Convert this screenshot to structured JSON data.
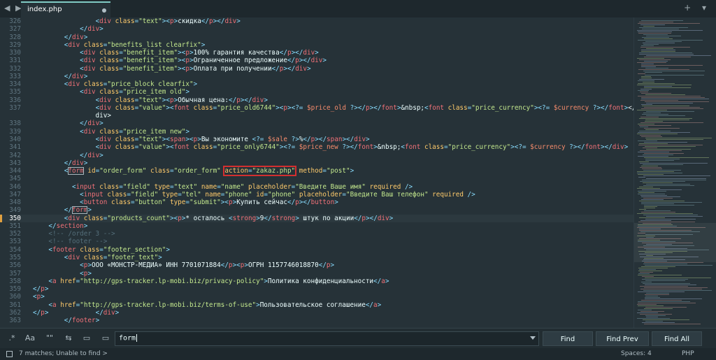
{
  "tabbar": {
    "nav_arrows": "◀ ▶",
    "tab_label": "index.php",
    "right_controls": "+ ▾"
  },
  "editor": {
    "current_line": "350",
    "lines": [
      {
        "n": "326",
        "code": "                <div class=\"text\"><p>скидка</p></div>"
      },
      {
        "n": "327",
        "code": "            </div>"
      },
      {
        "n": "328",
        "code": "        </div>"
      },
      {
        "n": "329",
        "code": "        <div class=\"benefits_list clearfix\">"
      },
      {
        "n": "330",
        "code": "            <div class=\"benefit_item\"><p>100% гарантия качества</p></div>"
      },
      {
        "n": "331",
        "code": "            <div class=\"benefit_item\"><p>Ограниченное предложение</p></div>"
      },
      {
        "n": "332",
        "code": "            <div class=\"benefit_item\"><p>Оплата при получении</p></div>"
      },
      {
        "n": "333",
        "code": "        </div>"
      },
      {
        "n": "334",
        "code": "        <div class=\"price_block clearfix\">"
      },
      {
        "n": "335",
        "code": "            <div class=\"price_item old\">"
      },
      {
        "n": "336",
        "code": "                <div class=\"text\"><p>Обычная цена:</p></div>"
      },
      {
        "n": "337",
        "code": "                <div class=\"value\"><font class=\"price_old6744\"><p><?= $price_old ?></p></font>&nbsp;<font class=\"price_currency\"><?= $currency ?></font></"
      },
      {
        "n": "",
        "code": "                div>"
      },
      {
        "n": "338",
        "code": "            </div>"
      },
      {
        "n": "339",
        "code": "            <div class=\"price_item new\">"
      },
      {
        "n": "340",
        "code": "                <div class=\"text\"><span><p>Вы экономите <?= $sale ?>%</p></span></div>"
      },
      {
        "n": "341",
        "code": "                <div class=\"value\"><font class=\"price_only6744\"><?= $price_new ?></font>&nbsp;<font class=\"price_currency\"><?= $currency ?></font></div>"
      },
      {
        "n": "342",
        "code": "            </div>"
      },
      {
        "n": "343",
        "code": "        </div>"
      },
      {
        "n": "344",
        "code": "        <form id=\"order_form\" class=\"order_form\" action=\"zakaz.php\" method=\"post\">"
      },
      {
        "n": "345",
        "code": ""
      },
      {
        "n": "346",
        "code": "          <input class=\"field\" type=\"text\" name=\"name\" placeholder=\"Введите Ваше имя\" required />"
      },
      {
        "n": "347",
        "code": "            <input class=\"field\" type=\"tel\" name=\"phone\" id=\"phone\" placeholder=\"Введите Ваш телефон\" required />"
      },
      {
        "n": "348",
        "code": "            <button class=\"button\" type=\"submit\"><p>Купить сейчас</p></button>"
      },
      {
        "n": "349",
        "code": "        </form>"
      },
      {
        "n": "350",
        "code": "        <div class=\"products_count\"><p>* осталось <strong>9</strong> штук по акции</p></div>"
      },
      {
        "n": "351",
        "code": "    </section>"
      },
      {
        "n": "352",
        "code": "    <!-- /order 3 -->"
      },
      {
        "n": "353",
        "code": "    <!-- footer -->"
      },
      {
        "n": "354",
        "code": "    <footer class=\"footer_section\">"
      },
      {
        "n": "355",
        "code": "        <div class=\"footer_text\">"
      },
      {
        "n": "356",
        "code": "            <p>ООО «МОНСТР-МЕДИА» ИНН 7701071884</p><p>ОГРН 1157746018870</p>"
      },
      {
        "n": "357",
        "code": "            <p>"
      },
      {
        "n": "358",
        "code": "    <a href=\"http://gps-tracker.lp-mobi.biz/privacy-policy\">Политика конфиденциальности</a>"
      },
      {
        "n": "359",
        "code": "</p>"
      },
      {
        "n": "360",
        "code": "<p>"
      },
      {
        "n": "361",
        "code": "    <a href=\"http://gps-tracker.lp-mobi.biz/terms-of-use\">Пользовательское соглашение</a>"
      },
      {
        "n": "362",
        "code": "</p>            </div>"
      },
      {
        "n": "363",
        "code": "        </footer>"
      }
    ]
  },
  "find_panel": {
    "options": [
      ".*",
      "Aa",
      "\"\"",
      "⇆",
      "▭",
      "▭"
    ],
    "query": "form",
    "find_label": "Find",
    "find_prev_label": "Find Prev",
    "find_all_label": "Find All"
  },
  "status": {
    "message": "7 matches; Unable to find >",
    "spaces": "Spaces: 4",
    "syntax": "PHP"
  },
  "colors": {
    "background": "#263238",
    "tag": "#f07178",
    "attribute": "#ffcb6b",
    "string": "#c3e88d",
    "punctuation": "#89ddff",
    "variable": "#f78c6c",
    "comment": "#546e7a",
    "highlight_box": "#d32f2f"
  }
}
